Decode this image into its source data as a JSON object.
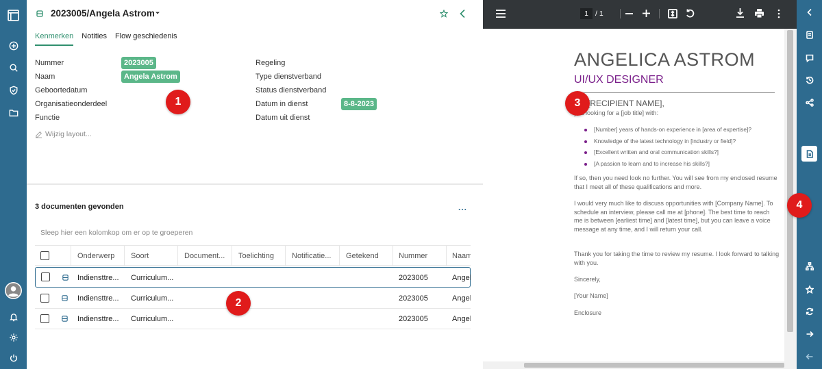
{
  "header": {
    "title": "2023005/Angela Astrom"
  },
  "tabs": [
    {
      "label": "Kenmerken",
      "active": true
    },
    {
      "label": "Notities",
      "active": false
    },
    {
      "label": "Flow geschiedenis",
      "active": false
    }
  ],
  "fields_left": [
    {
      "label": "Nummer",
      "value": "2023005"
    },
    {
      "label": "Naam",
      "value": "Angela Astrom"
    },
    {
      "label": "Geboortedatum",
      "value": ""
    },
    {
      "label": "Organisatieonderdeel",
      "value": ""
    },
    {
      "label": "Functie",
      "value": ""
    }
  ],
  "fields_right": [
    {
      "label": "Regeling",
      "value": ""
    },
    {
      "label": "Type dienstverband",
      "value": ""
    },
    {
      "label": "Status dienstverband",
      "value": ""
    },
    {
      "label": "Datum in dienst",
      "value": "8-8-2023"
    },
    {
      "label": "Datum uit dienst",
      "value": ""
    }
  ],
  "layout_link": "Wijzig layout...",
  "documents": {
    "count_label": "3 documenten gevonden",
    "more": "...",
    "group_hint": "Sleep hier een kolomkop om er op te groeperen",
    "columns": [
      "Onderwerp",
      "Soort",
      "Document...",
      "Toelichting",
      "Notificatie...",
      "Getekend",
      "Nummer",
      "Naam"
    ],
    "rows": [
      {
        "onderwerp": "Indiensttre...",
        "soort": "Curriculum...",
        "nummer": "2023005",
        "naam": "Angel"
      },
      {
        "onderwerp": "Indiensttre...",
        "soort": "Curriculum...",
        "nummer": "2023005",
        "naam": "Angel"
      },
      {
        "onderwerp": "Indiensttre...",
        "soort": "Curriculum...",
        "nummer": "2023005",
        "naam": "Angel"
      }
    ]
  },
  "pdf": {
    "page_current": "1",
    "page_total": "1",
    "name": "ANGELICA ASTROM",
    "role": "UI/UX DESIGNER",
    "dear": "AR [RECIPIENT NAME],",
    "intro": "you looking for a [job title] with:",
    "bullets": [
      "[Number] years of hands-on experience in [area of expertise]?",
      "Knowledge of the latest technology in [industry or field]?",
      "[Excellent written and oral communication skills?]",
      "[A passion to learn and to increase his skills?]"
    ],
    "p1": "If so, then you need look no further. You will see from my enclosed resume that I meet all of these qualifications and more.",
    "p2": "I would very much like to discuss opportunities with [Company Name]. To schedule an interview, please call me at [phone]. The best time to reach me is between [earliest time] and [latest time], but you can leave a voice message at any time, and I will return your call.",
    "p3": "Thank you for taking the time to review my resume. I look forward to talking with you.",
    "closing": "Sincerely,",
    "signature": "[Your Name]",
    "enclosure": "Enclosure"
  },
  "badges": [
    "1",
    "2",
    "3",
    "4"
  ],
  "colors": {
    "nav": "#2e6b8f",
    "accent": "#2f8f6e",
    "chip": "#5bb789",
    "badge": "#e01b1b",
    "pdf_toolbar": "#323639",
    "role": "#7a1f8a"
  },
  "icons": {
    "left_nav": [
      "panel-icon",
      "add-icon",
      "search-icon",
      "shield-icon",
      "folder-icon",
      "avatar",
      "bell-icon",
      "settings-icon",
      "power-icon"
    ],
    "right_rail": [
      "chevron-left-icon",
      "document-icon",
      "comment-icon",
      "history-icon",
      "share-icon",
      "file-icon",
      "hierarchy-icon",
      "star-icon",
      "refresh-icon",
      "arrow-right-icon",
      "arrow-left-icon"
    ]
  }
}
